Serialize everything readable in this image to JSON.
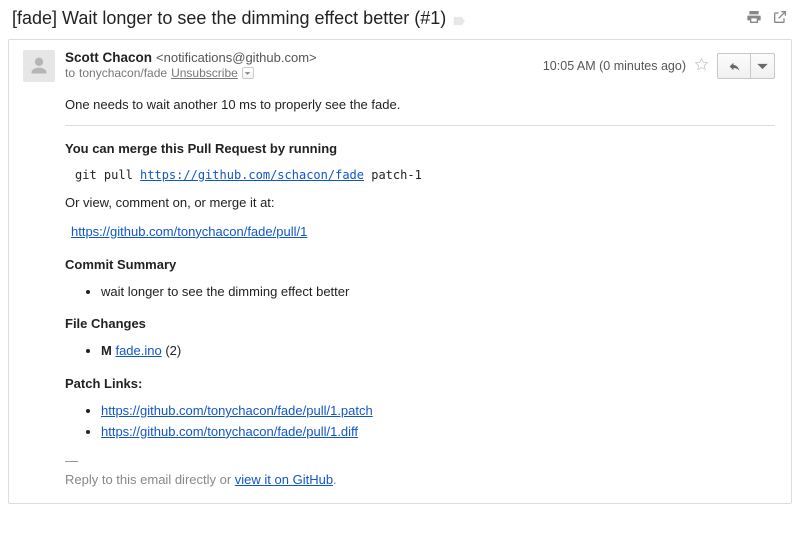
{
  "subject": "[fade] Wait longer to see the dimming effect better (#1)",
  "sender": {
    "name": "Scott Chacon",
    "address": "<notifications@github.com>",
    "to_prefix": "to",
    "to": "tonychacon/fade",
    "unsubscribe": "Unsubscribe"
  },
  "meta": {
    "time": "10:05 AM (0 minutes ago)"
  },
  "body": {
    "intro": "One needs to wait another 10 ms to properly see the fade.",
    "merge_heading": "You can merge this Pull Request by running",
    "git_cmd_prefix": "git pull ",
    "git_cmd_url": "https://github.com/schacon/fade",
    "git_cmd_suffix": " patch-1",
    "or_view_text": "Or view, comment on, or merge it at:",
    "pr_url": "https://github.com/tonychacon/fade/pull/1",
    "commit_summary_heading": "Commit Summary",
    "commit_summary_item": "wait longer to see the dimming effect better",
    "file_changes_heading": "File Changes",
    "file_change_flag": "M",
    "file_change_name": "fade.ino",
    "file_change_count": " (2)",
    "patch_links_heading": "Patch Links:",
    "patch_link_1": "https://github.com/tonychacon/fade/pull/1.patch",
    "patch_link_2": "https://github.com/tonychacon/fade/pull/1.diff",
    "sig_dash": "—",
    "sig_text": "Reply to this email directly or ",
    "sig_link": "view it on GitHub",
    "sig_period": "."
  }
}
